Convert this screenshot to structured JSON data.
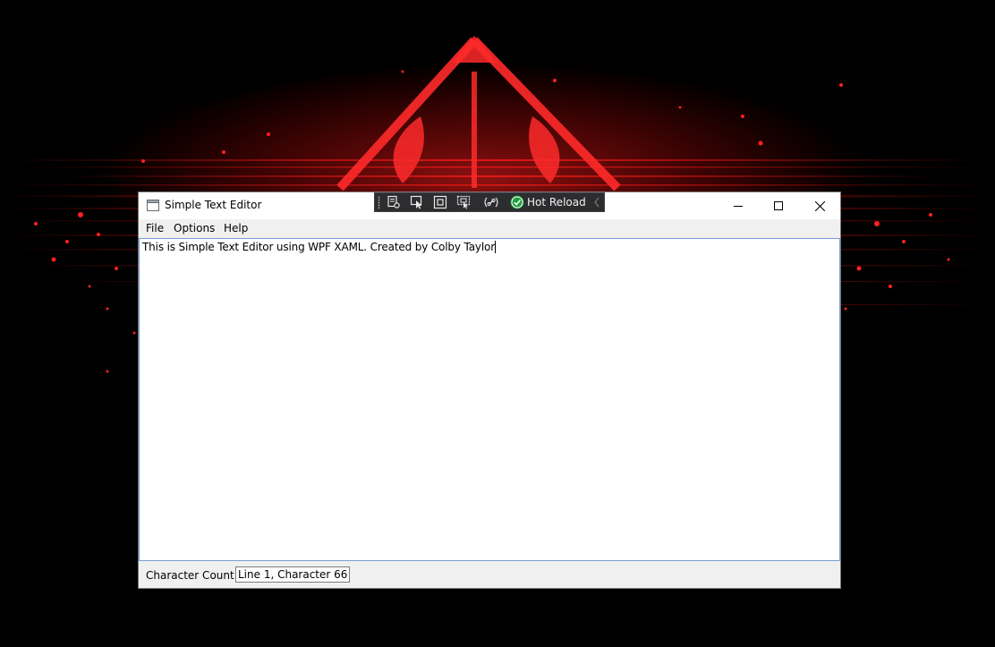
{
  "window": {
    "title": "Simple Text Editor",
    "accent_color": "#7a9cd3"
  },
  "hot_reload_toolbar": {
    "label": "Hot Reload",
    "buttons": [
      "live-visual-tree-icon",
      "select-element-icon",
      "display-layout-adorners-icon",
      "track-focused-element-icon",
      "binding-failures-icon"
    ],
    "status_icon": "green-check-icon"
  },
  "menu": {
    "items": [
      "File",
      "Options",
      "Help"
    ]
  },
  "editor": {
    "text": "This is Simple Text Editor using WPF XAML. Created by Colby Taylor"
  },
  "statusbar": {
    "label": "Character Count:",
    "value": "Line 1, Character 66"
  },
  "colors": {
    "wallpaper_bg": "#000000",
    "wallpaper_accent": "#e01010",
    "chrome_bg": "#f0f0f0",
    "toolbar_bg": "#2d2d30"
  }
}
